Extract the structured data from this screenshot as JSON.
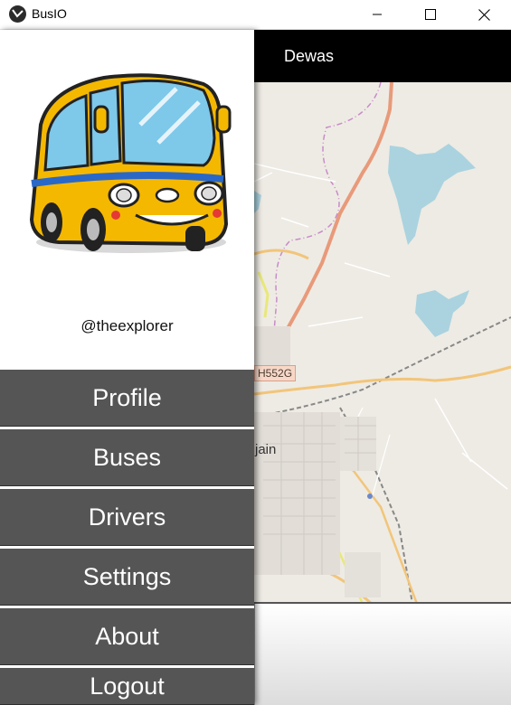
{
  "window": {
    "title": "BusIO",
    "minimize_icon": "minimize-icon",
    "maximize_icon": "maximize-icon",
    "close_icon": "close-icon"
  },
  "map": {
    "city": "Dewas",
    "road_label": "H552G",
    "place_label": "jain",
    "colors": {
      "land": "#eeebe4",
      "water": "#aad3df",
      "highway": "#e89a7a",
      "road": "#f2c57a"
    }
  },
  "drawer": {
    "username": "@theexplorer",
    "illustration": "school-bus-illustration",
    "menu": [
      {
        "label": "Profile"
      },
      {
        "label": "Buses"
      },
      {
        "label": "Drivers"
      },
      {
        "label": "Settings"
      },
      {
        "label": "About"
      },
      {
        "label": "Logout"
      }
    ],
    "menu_color": "#555555"
  }
}
